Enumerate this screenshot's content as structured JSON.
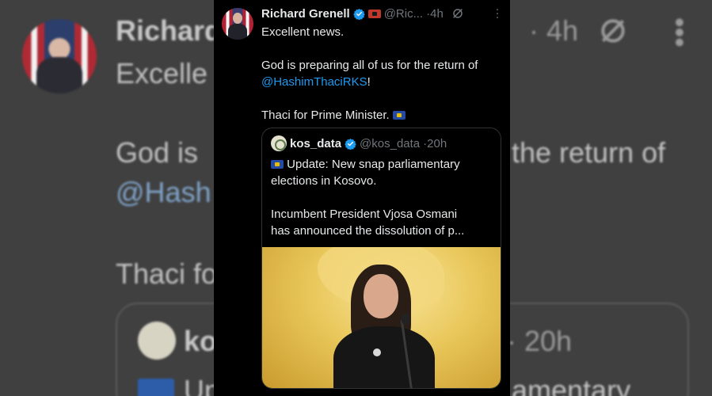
{
  "tweet": {
    "author_name": "Richard Grenell",
    "handle": "@Ric...",
    "time": "·4h",
    "lines": [
      "Excellent news.",
      "",
      "God is preparing all of us for the return of",
      "@HashimThaciRKS",
      "!",
      "",
      "Thaci for Prime Minister."
    ]
  },
  "quote": {
    "name": "kos_data",
    "handle": "@kos_data",
    "time": "·20h",
    "lines": [
      "Update: New snap parliamentary",
      "elections in Kosovo.",
      "",
      "Incumbent President Vjosa Osmani",
      "has announced the dissolution of p..."
    ]
  },
  "background": {
    "name": "Richard",
    "time": "· 4h",
    "line1": "Excelle",
    "line2a": "God is",
    "line2b": "the return of",
    "line3": "@Hash",
    "line4": "Thaci fo",
    "quote_name": "ko",
    "quote_time": "· 20h",
    "quote_line_a": "Up",
    "quote_line_b": "amentary"
  },
  "colors": {
    "link": "#1d9bf0",
    "verified": "#1d9bf0",
    "text": "#e7e9ea",
    "muted": "#71767b"
  },
  "icons": {
    "verified": "verified-badge-icon",
    "grok": "grok-icon",
    "more": "more-icon"
  }
}
